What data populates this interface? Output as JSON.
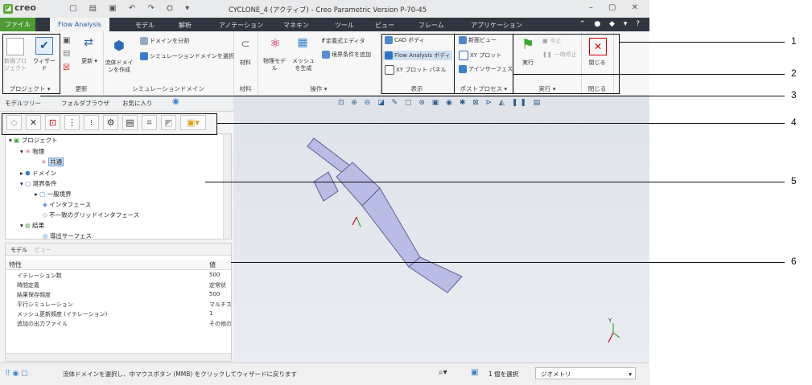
{
  "app": {
    "logo": "creo",
    "window_title": "CYCLONE_4 (アクティブ) - Creo Parametric Version P-70-45"
  },
  "tabs": [
    "ファイル",
    "Flow Analysis",
    "モデル",
    "解析",
    "アノテーション",
    "マネキン",
    "ツール",
    "ビュー",
    "フレーム",
    "アプリケーション"
  ],
  "ribbon": {
    "project": {
      "new_project": "新規プロジェクト",
      "wizard": "ウィザード",
      "label": "プロジェクト ▾"
    },
    "update": {
      "button": "更新 ▾",
      "label": "更新"
    },
    "sim_domain": {
      "fluid_domain": "流体ドメインを作成",
      "split_domain": "ドメインを分割",
      "select_sim_domain": "シミュレーションドメインを選択",
      "label": "シミュレーションドメイン"
    },
    "material": {
      "button": "材料",
      "label": "材料"
    },
    "operation": {
      "physics_model": "物理モデル",
      "mesh_create": "メッシュを生成",
      "formula_editor": "定義式エディタ",
      "add_boundary": "境界条件を追加",
      "label": "操作 ▾"
    },
    "display": {
      "cad_body": "CAD ボディ",
      "flow_body": "Flow Analysis ボディ",
      "xy_panel": "XY プロット パネル",
      "label": "表示"
    },
    "post": {
      "new_view": "新面ビュー",
      "xy_plot": "XY プロット",
      "iso_surface": "アイソサーフェス",
      "label": "ポストプロセス ▾"
    },
    "run": {
      "run": "実行",
      "stop": "中止",
      "pause": "一時停止",
      "label": "実行 ▾"
    },
    "close": {
      "button": "閉じる",
      "label": "閉じる"
    }
  },
  "panel_tabs": [
    "モデルツリー",
    "フォルダブラウザ",
    "お気に入り"
  ],
  "tree": [
    {
      "label": "プロジェクト",
      "level": 0
    },
    {
      "label": "物理",
      "level": 1
    },
    {
      "label": "共通",
      "level": 2
    },
    {
      "label": "ドメイン",
      "level": 1
    },
    {
      "label": "境界条件",
      "level": 1
    },
    {
      "label": "一般境界",
      "level": 2
    },
    {
      "label": "インタフェース",
      "level": 2
    },
    {
      "label": "不一致のグリッドインタフェース",
      "level": 2
    },
    {
      "label": "結果",
      "level": 1
    },
    {
      "label": "導出サーフェス",
      "level": 2
    }
  ],
  "props": {
    "tabs": [
      "モデル",
      "ビュー"
    ],
    "header_key": "特性",
    "header_val": "値",
    "rows": [
      {
        "k": "イテレーション数",
        "v": "500"
      },
      {
        "k": "時間定義",
        "v": "定常状"
      },
      {
        "k": "結果保存頻度",
        "v": "500"
      },
      {
        "k": "平行シミュレーション",
        "v": "マルチス"
      },
      {
        "k": "メッシュ更新頻度 (イテレーション)",
        "v": "1"
      },
      {
        "k": "追加の出力ファイル",
        "v": "その他の"
      }
    ]
  },
  "status": {
    "message": "流体ドメインを選択し、中マウスボタン (MMB) をクリックしてウィザードに戻ります",
    "selected": "1 個を選択",
    "filter": "ジオメトリ"
  },
  "callouts": [
    "1",
    "2",
    "3",
    "4",
    "5",
    "6"
  ]
}
